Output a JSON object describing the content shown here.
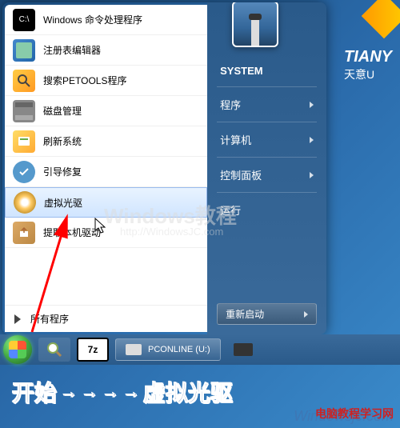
{
  "desktop": {
    "logo": "TIANY",
    "sub": "天意U",
    "user": "SYSTEM"
  },
  "menu": {
    "items": [
      {
        "label": "Windows 命令处理程序"
      },
      {
        "label": "注册表编辑器"
      },
      {
        "label": "搜索PETOOLS程序"
      },
      {
        "label": "磁盘管理"
      },
      {
        "label": "刷新系统"
      },
      {
        "label": "引导修复"
      },
      {
        "label": "虚拟光驱"
      },
      {
        "label": "提取本机驱动"
      }
    ],
    "all_programs": "所有程序"
  },
  "right": {
    "programs": "程序",
    "computer": "计算机",
    "control_panel": "控制面板",
    "run": "运行",
    "restart": "重新启动"
  },
  "taskbar": {
    "seven_zip": "7z",
    "drive": "PCONLINE (U:)"
  },
  "watermark": {
    "main": "Windows教程",
    "sub": "http://WindowsJC.com"
  },
  "footer": {
    "start": "开始",
    "target": "虚拟光驱",
    "arrow": "→"
  },
  "bottom_wm": "Windowsjc.com",
  "site_wm": "电脑教程学习网"
}
